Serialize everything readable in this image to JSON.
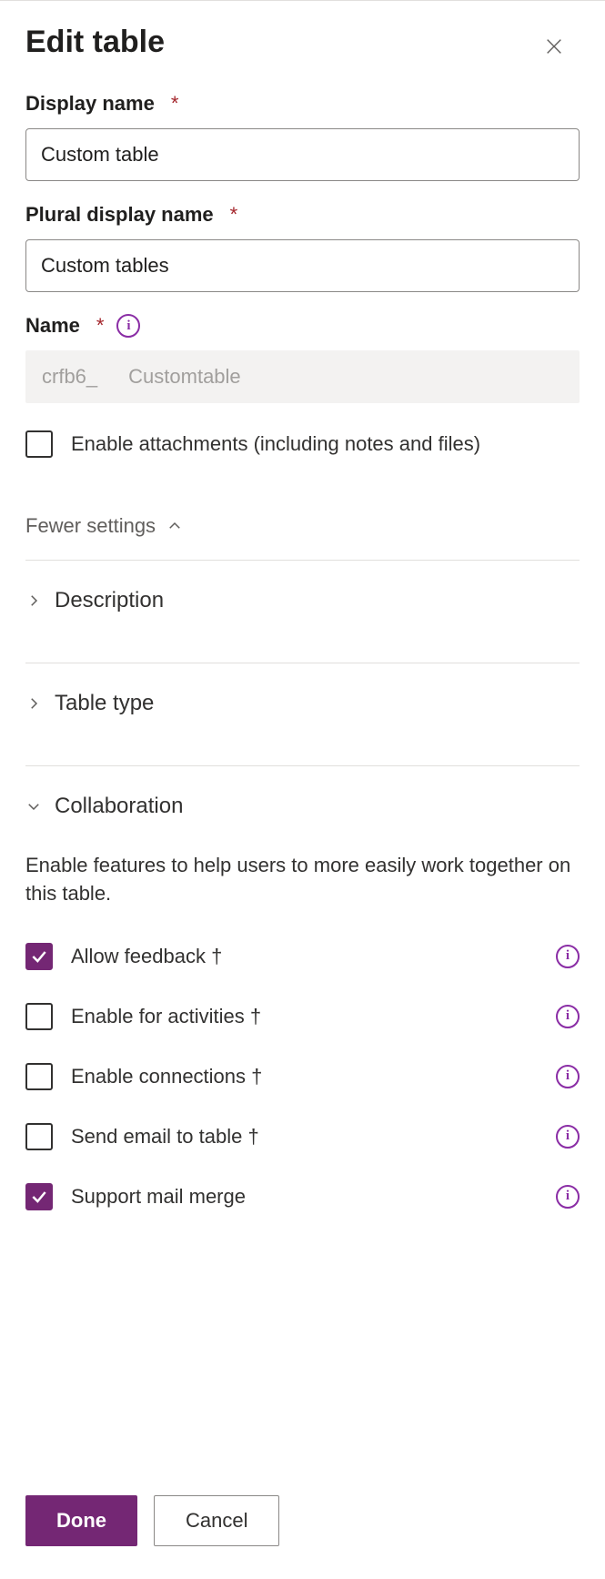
{
  "header": {
    "title": "Edit table"
  },
  "fields": {
    "display_name": {
      "label": "Display name",
      "value": "Custom table"
    },
    "plural_name": {
      "label": "Plural display name",
      "value": "Custom tables"
    },
    "name": {
      "label": "Name",
      "prefix": "crfb6_",
      "value": "Customtable"
    },
    "attachments": {
      "label": "Enable attachments (including notes and files)",
      "checked": false
    }
  },
  "settings_toggle": "Fewer settings",
  "sections": {
    "description": {
      "title": "Description"
    },
    "table_type": {
      "title": "Table type"
    },
    "collaboration": {
      "title": "Collaboration",
      "desc": "Enable features to help users to more easily work together on this table.",
      "items": [
        {
          "label": "Allow feedback †",
          "checked": true,
          "info": true
        },
        {
          "label": "Enable for activities †",
          "checked": false,
          "info": true
        },
        {
          "label": "Enable connections †",
          "checked": false,
          "info": true
        },
        {
          "label": "Send email to table †",
          "checked": false,
          "info": true
        },
        {
          "label": "Support mail merge",
          "checked": true,
          "info": true
        }
      ]
    }
  },
  "footer": {
    "done": "Done",
    "cancel": "Cancel"
  }
}
